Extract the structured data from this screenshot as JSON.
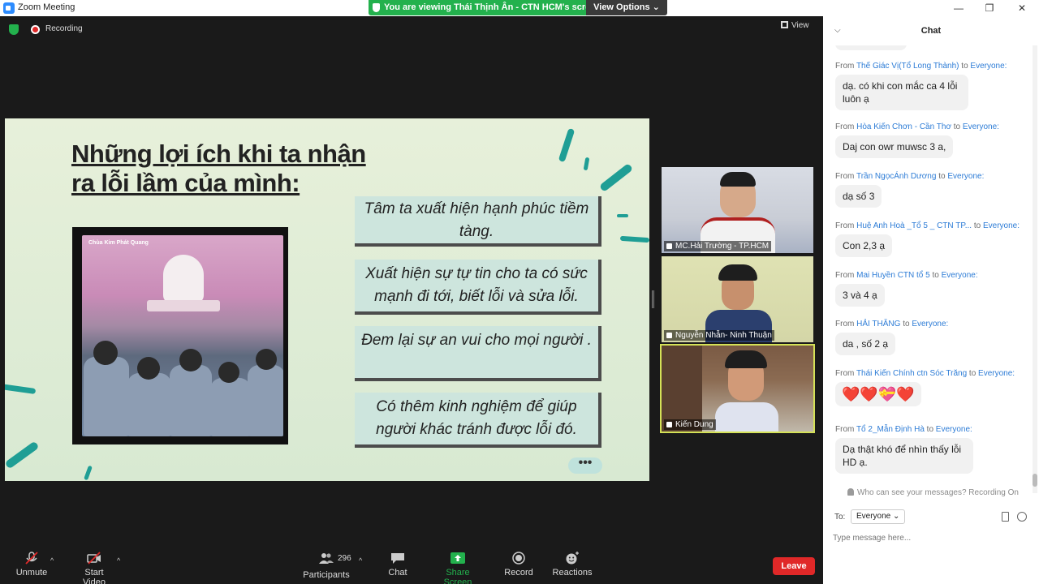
{
  "window": {
    "title": "Zoom Meeting",
    "controls": {
      "minimize": "—",
      "maximize": "❐",
      "close": "✕"
    }
  },
  "banner": {
    "viewing_text": "You are viewing Thái Thịnh Ân - CTN HCM's screen",
    "view_options": "View Options ⌄"
  },
  "meeting": {
    "recording_label": "Recording",
    "view_label": "View"
  },
  "slide": {
    "title": "Những lợi ích khi ta nhận ra lỗi lầm của mình:",
    "photo_logo": "Chùa Kim Phát Quang",
    "benefits": [
      "Tâm ta xuất hiện  hạnh phúc tiềm tàng.",
      "Xuất hiện sự tự tin cho ta có sức mạnh đi tới, biết lỗi và sửa lỗi.",
      "Đem lại sự an vui cho mọi người .",
      "Có thêm kinh nghiệm để giúp người khác tránh được lỗi đó."
    ],
    "more": "•••"
  },
  "participants_video": [
    {
      "name": "MC.Hải Trường - TP.HCM"
    },
    {
      "name": "Nguyễn Nhẫn- Ninh Thuận"
    },
    {
      "name": "Kiến Dung"
    }
  ],
  "toolbar": {
    "unmute": "Unmute",
    "start_video": "Start Video",
    "participants_count": "296",
    "participants": "Participants",
    "chat": "Chat",
    "share_screen": "Share Screen",
    "record": "Record",
    "reactions": "Reactions",
    "leave": "Leave",
    "accent_green": "#23b14d",
    "leave_red": "#e02828"
  },
  "chat": {
    "title": "Chat",
    "messages": [
      {
        "from_label": "From",
        "sender": "Thế Giác Vị(Tổ Long Thành)",
        "to_label": "to",
        "recipient": "Everyone:",
        "text": "dạ. có khi con mắc ca 4 lỗi luôn ạ"
      },
      {
        "from_label": "From",
        "sender": "Hòa Kiến Chơn - Cần Thơ",
        "to_label": "to",
        "recipient": "Everyone:",
        "text": "Daj con owr muwsc 3 a,"
      },
      {
        "from_label": "From",
        "sender": "Trần NgọcÁnh Dương",
        "to_label": "to",
        "recipient": "Everyone:",
        "text": "dạ số 3"
      },
      {
        "from_label": "From",
        "sender": "Huệ Anh Hoà _Tổ 5 _ CTN TP...",
        "to_label": "to",
        "recipient": "Everyone:",
        "text": "Con 2,3 ạ"
      },
      {
        "from_label": "From",
        "sender": "Mai Huyền CTN tổ 5",
        "to_label": "to",
        "recipient": "Everyone:",
        "text": "3 và 4 ạ"
      },
      {
        "from_label": "From",
        "sender": "HẢI THĂNG",
        "to_label": "to",
        "recipient": "Everyone:",
        "text": "da , số 2 ạ"
      },
      {
        "from_label": "From",
        "sender": "Thái Kiến Chính ctn Sóc Trăng",
        "to_label": "to",
        "recipient": "Everyone:",
        "text": "❤️❤️💝❤️"
      },
      {
        "from_label": "From",
        "sender": "Tổ 2_Mẫn Định Hà",
        "to_label": "to",
        "recipient": "Everyone:",
        "text": "Dạ thật khó để nhìn thấy lỗi HD ạ."
      }
    ],
    "privacy_note": "Who can see your messages? Recording On",
    "to_label": "To:",
    "recipient_select": "Everyone ⌄",
    "input_placeholder": "Type message here..."
  }
}
